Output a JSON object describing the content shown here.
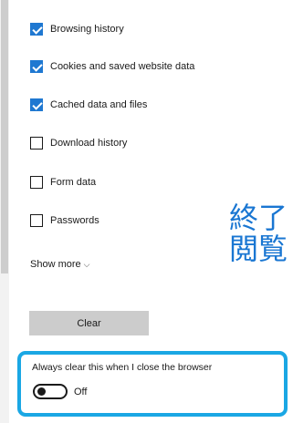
{
  "options": [
    {
      "label": "Browsing history",
      "checked": true
    },
    {
      "label": "Cookies and saved website data",
      "checked": true
    },
    {
      "label": "Cached data and files",
      "checked": true
    },
    {
      "label": "Download history",
      "checked": false
    },
    {
      "label": "Form data",
      "checked": false
    },
    {
      "label": "Passwords",
      "checked": false
    }
  ],
  "show_more": {
    "label": "Show more",
    "chevron": "⌵"
  },
  "clear_button": {
    "label": "Clear"
  },
  "always_clear": {
    "label": "Always clear this when I close the browser",
    "toggle_state": "Off"
  },
  "overlay": {
    "line1": "終了",
    "line2": "閲覧"
  },
  "colors": {
    "accent_blue": "#1f78d1",
    "highlight_border": "#1aa7e4",
    "overlay_text": "#1976d2"
  }
}
